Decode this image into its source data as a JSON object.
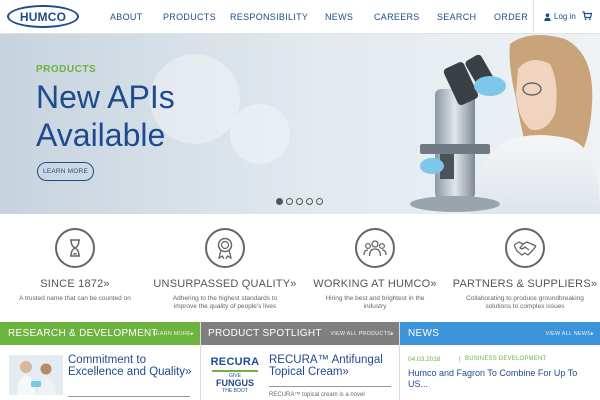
{
  "header": {
    "logo_text": "HUMCO",
    "nav": [
      "ABOUT",
      "PRODUCTS",
      "RESPONSIBILITY",
      "NEWS",
      "CAREERS",
      "SEARCH",
      "ORDER"
    ],
    "login_label": "Log in"
  },
  "hero": {
    "eyebrow": "PRODUCTS",
    "title_line1": "New APIs",
    "title_line2": "Available",
    "button_label": "LEARN MORE",
    "slide_count": 5,
    "active_slide": 1
  },
  "features": [
    {
      "icon": "hourglass-icon",
      "title": "SINCE 1872",
      "desc": "A trusted name that can be counted on"
    },
    {
      "icon": "award-ribbon-icon",
      "title": "UNSURPASSED QUALITY",
      "desc": "Adhering to the highest standards to improve the quality of people's lives"
    },
    {
      "icon": "people-group-icon",
      "title": "WORKING AT HUMCO",
      "desc": "Hiring the best and brightest in the industry"
    },
    {
      "icon": "handshake-icon",
      "title": "PARTNERS & SUPPLIERS",
      "desc": "Collaborating to produce groundbreaking solutions to complex issues"
    }
  ],
  "panels": {
    "rd": {
      "title": "RESEARCH & DEVELOPMENT",
      "link": "LEARN MORE",
      "headline": "Commitment to Excellence and Quality"
    },
    "spotlight": {
      "title": "PRODUCT SPOTLIGHT",
      "link": "VIEW ALL PRODUCTS",
      "logo_brand": "RECURA",
      "logo_tag1": "GIVE",
      "logo_tag2": "FUNGUS",
      "logo_tag3": "THE BOOT",
      "headline": "RECURA™ Antifungal Topical Cream",
      "desc": "RECURA™ topical cream is a novel"
    },
    "news": {
      "title": "NEWS",
      "link": "VIEW ALL NEWS",
      "date": "04.03.2018",
      "category": "BUSINESS DEVELOPMENT",
      "headline": "Humco and Fagron To Combine For Up To US..."
    }
  },
  "colors": {
    "brand_blue": "#1e4b8f",
    "green": "#6cb33f",
    "grey_bar": "#7f7f7f",
    "news_blue": "#3d93d8"
  }
}
